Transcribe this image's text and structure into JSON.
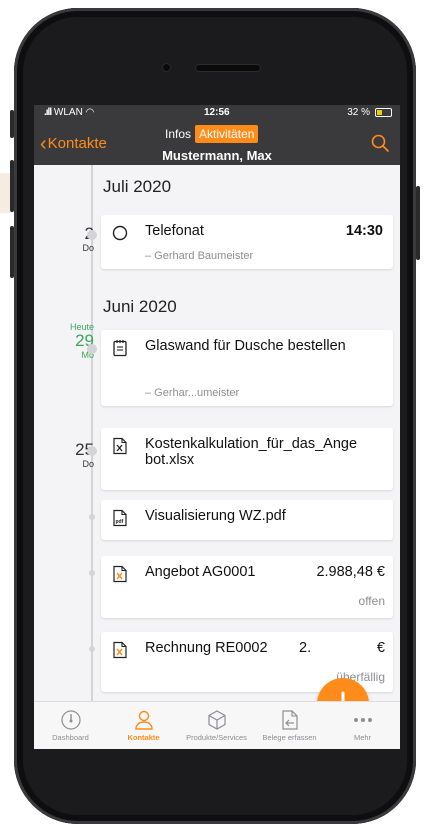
{
  "status_bar": {
    "carrier": "WLAN",
    "time": "12:56",
    "battery": "32 %"
  },
  "nav": {
    "back_label": "Kontakte",
    "segments": [
      "Infos",
      "Aktivitäten"
    ],
    "active_segment": "Aktivitäten",
    "title": "Mustermann, Max"
  },
  "timeline": {
    "month_july": "Juli 2020",
    "month_june": "Juni 2020",
    "date_2": {
      "num": "2",
      "day": "Do"
    },
    "date_29": {
      "today": "Heute",
      "num": "29",
      "day": "Mo"
    },
    "date_25": {
      "num": "25",
      "day": "Do"
    }
  },
  "activities": {
    "telefonat": {
      "title": "Telefonat",
      "time": "14:30",
      "by": "– Gerhard Baumeister"
    },
    "glaswand": {
      "title": "Glaswand für Dusche bestellen",
      "by": "– Gerhar...umeister"
    },
    "kosten": {
      "title_line1": "Kostenkalkulation_für_das_Ange",
      "title_line2": "bot.xlsx"
    },
    "visual": {
      "title": "Visualisierung WZ.pdf"
    },
    "angebot": {
      "title": "Angebot AG0001",
      "amount": "2.988,48 €",
      "status": "offen"
    },
    "rechnung": {
      "title": "Rechnung RE0002",
      "amount": "2.",
      "amount_tail": "€",
      "status": "überfällig"
    }
  },
  "tabbar": {
    "items": [
      "Dashboard",
      "Kontakte",
      "Produkte/Services",
      "Belege erfassen",
      "Mehr"
    ],
    "active": "Kontakte"
  },
  "colors": {
    "accent": "#ff8c1a",
    "navbar": "#3a3a3c",
    "today": "#3aa857"
  },
  "icons": [
    "chevron-left-icon",
    "search-icon",
    "circle-icon",
    "note-icon",
    "excel-file-icon",
    "pdf-file-icon",
    "plus-icon",
    "dashboard-icon",
    "person-icon",
    "box-icon",
    "document-import-icon",
    "more-icon"
  ]
}
